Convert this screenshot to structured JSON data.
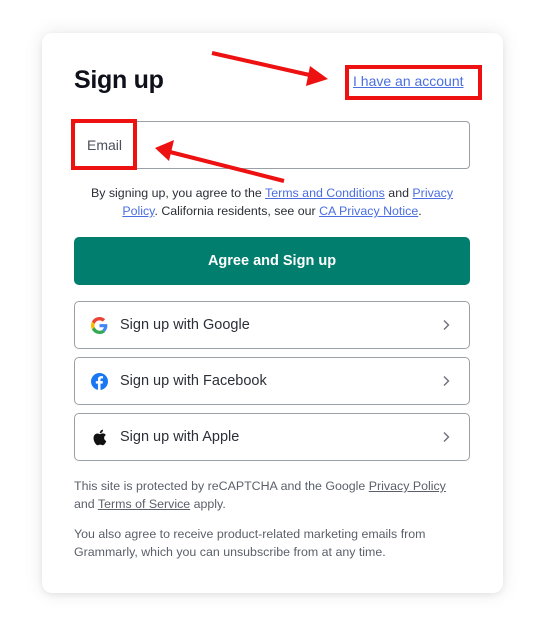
{
  "signup": {
    "title": "Sign up",
    "have_account_link": "I have an account",
    "email_placeholder": "Email",
    "consent": {
      "prefix": "By signing up, you agree to the ",
      "terms_link": "Terms and Conditions",
      "and": " and ",
      "privacy_link": "Privacy Policy",
      "middle": ". California residents, see our ",
      "ca_link": "CA Privacy Notice",
      "suffix": "."
    },
    "primary_button": "Agree and Sign up",
    "social": [
      {
        "label": "Sign up with Google",
        "icon": "google-icon"
      },
      {
        "label": "Sign up with Facebook",
        "icon": "facebook-icon"
      },
      {
        "label": "Sign up with Apple",
        "icon": "apple-icon"
      }
    ],
    "recaptcha": {
      "prefix": "This site is protected by reCAPTCHA and the Google ",
      "privacy_link": "Privacy Policy",
      "and": " and ",
      "terms_link": "Terms of Service",
      "suffix": " apply."
    },
    "marketing": "You also agree to receive product-related marketing emails from Grammarly, which you can unsubscribe from at any time."
  },
  "colors": {
    "primary": "#027e6f",
    "link": "#4a6ee0",
    "annotation": "#ee1111",
    "facebook": "#1877f2"
  }
}
